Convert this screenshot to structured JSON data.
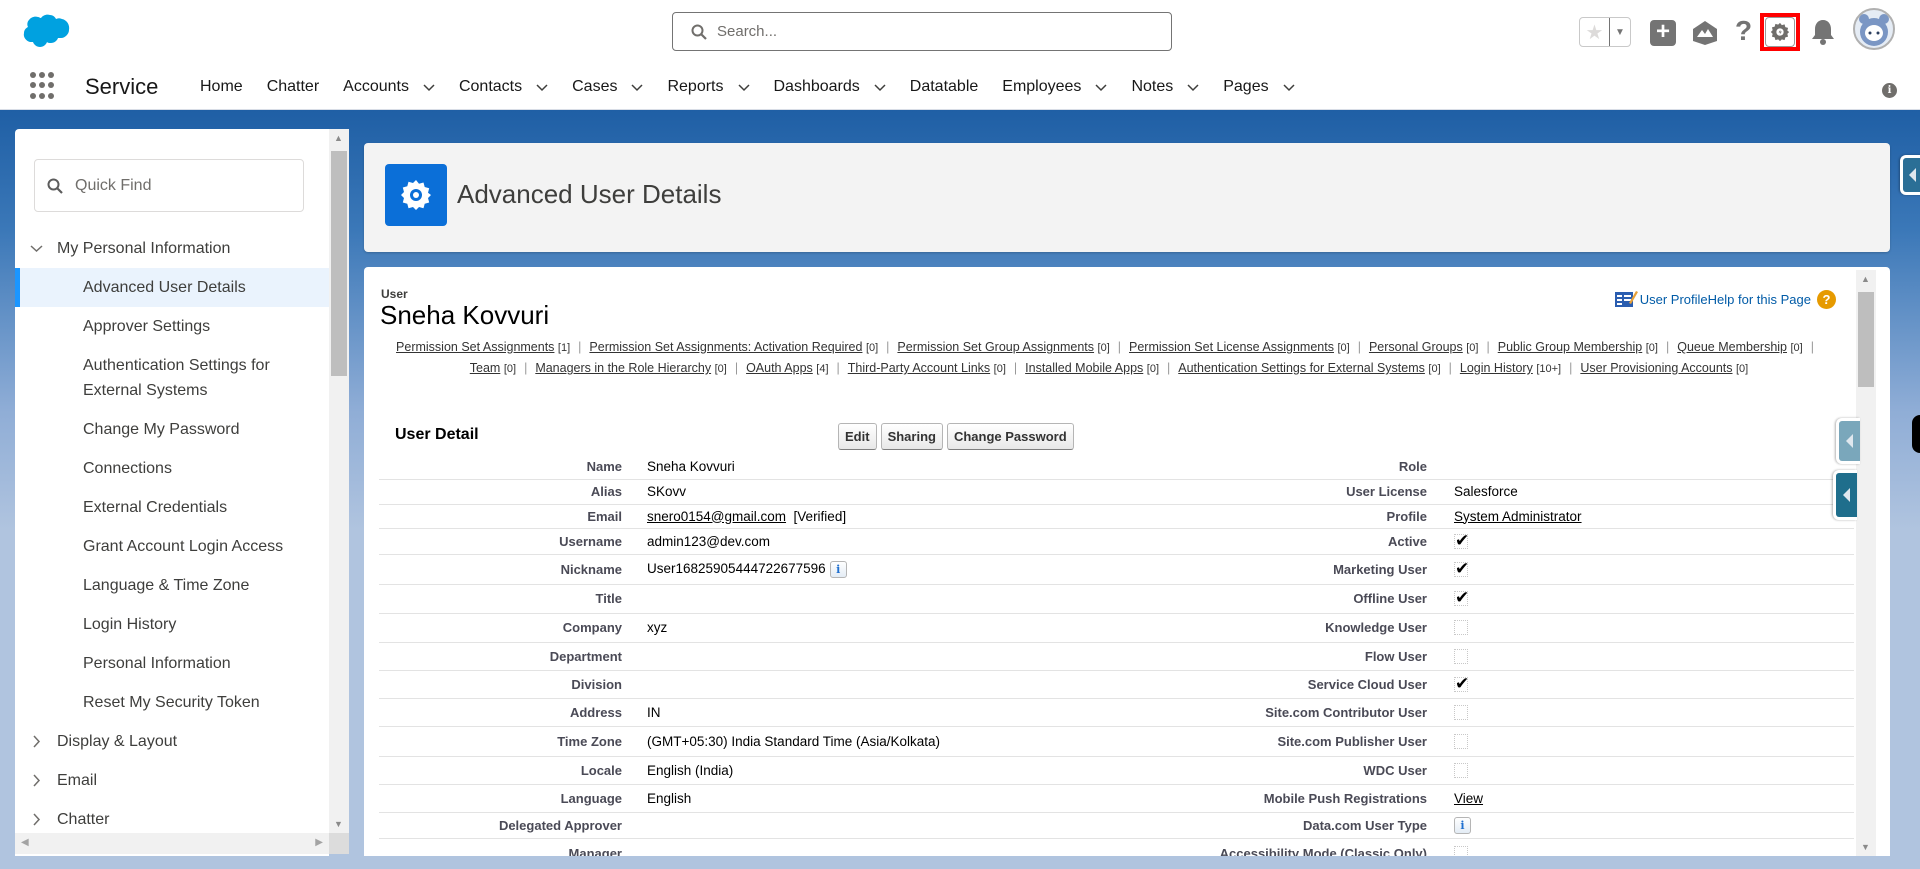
{
  "header": {
    "search_placeholder": "Search...",
    "icons": [
      "salesforce-logo",
      "favorites-star-icon",
      "favorites-dropdown-icon",
      "global-actions-plus-icon",
      "trailhead-icon",
      "help-icon",
      "setup-gear-icon",
      "notifications-bell-icon",
      "user-avatar"
    ],
    "highlight_color": "#ff0000"
  },
  "app_nav": {
    "app_name": "Service",
    "items": [
      {
        "label": "Home",
        "dropdown": false
      },
      {
        "label": "Chatter",
        "dropdown": false
      },
      {
        "label": "Accounts",
        "dropdown": true
      },
      {
        "label": "Contacts",
        "dropdown": true
      },
      {
        "label": "Cases",
        "dropdown": true
      },
      {
        "label": "Reports",
        "dropdown": true
      },
      {
        "label": "Dashboards",
        "dropdown": true
      },
      {
        "label": "Datatable",
        "dropdown": false
      },
      {
        "label": "Employees",
        "dropdown": true
      },
      {
        "label": "Notes",
        "dropdown": true
      },
      {
        "label": "Pages",
        "dropdown": true
      }
    ]
  },
  "sidebar": {
    "quick_find_placeholder": "Quick Find",
    "sections": [
      {
        "label": "My Personal Information",
        "expanded": true,
        "children": [
          {
            "label": "Advanced User Details",
            "selected": true
          },
          {
            "label": "Approver Settings",
            "selected": false
          },
          {
            "label": "Authentication Settings for External Systems",
            "selected": false
          },
          {
            "label": "Change My Password",
            "selected": false
          },
          {
            "label": "Connections",
            "selected": false
          },
          {
            "label": "External Credentials",
            "selected": false
          },
          {
            "label": "Grant Account Login Access",
            "selected": false
          },
          {
            "label": "Language & Time Zone",
            "selected": false
          },
          {
            "label": "Login History",
            "selected": false
          },
          {
            "label": "Personal Information",
            "selected": false
          },
          {
            "label": "Reset My Security Token",
            "selected": false
          }
        ]
      },
      {
        "label": "Display & Layout",
        "expanded": false
      },
      {
        "label": "Email",
        "expanded": false
      },
      {
        "label": "Chatter",
        "expanded": false
      }
    ]
  },
  "page": {
    "title": "Advanced User Details",
    "title_icon_color": "#0b6fd8"
  },
  "user": {
    "type_label": "User",
    "name": "Sneha Kovvuri",
    "profile_link": "User Profile",
    "help_link": "Help for this Page"
  },
  "related_links": [
    {
      "label": "Permission Set Assignments",
      "count": "[1]"
    },
    {
      "label": "Permission Set Assignments: Activation Required",
      "count": "[0]"
    },
    {
      "label": "Permission Set Group Assignments",
      "count": "[0]"
    },
    {
      "label": "Permission Set License Assignments",
      "count": "[0]"
    },
    {
      "label": "Personal Groups",
      "count": "[0]"
    },
    {
      "label": "Public Group Membership",
      "count": "[0]"
    },
    {
      "label": "Queue Membership",
      "count": "[0]"
    },
    {
      "label": "Team",
      "count": "[0]"
    },
    {
      "label": "Managers in the Role Hierarchy",
      "count": "[0]"
    },
    {
      "label": "OAuth Apps",
      "count": "[4]"
    },
    {
      "label": "Third-Party Account Links",
      "count": "[0]"
    },
    {
      "label": "Installed Mobile Apps",
      "count": "[0]"
    },
    {
      "label": "Authentication Settings for External Systems",
      "count": "[0]"
    },
    {
      "label": "Login History",
      "count": "[10+]"
    },
    {
      "label": "User Provisioning Accounts",
      "count": "[0]"
    }
  ],
  "user_detail": {
    "section_title": "User Detail",
    "buttons": {
      "edit": "Edit",
      "sharing": "Sharing",
      "change_password": "Change Password"
    },
    "rows": [
      {
        "left_label": "Name",
        "left_value": "Sneha Kovvuri",
        "right_label": "Role",
        "right_value": ""
      },
      {
        "left_label": "Alias",
        "left_value": "SKovv",
        "right_label": "User License",
        "right_value": "Salesforce"
      },
      {
        "left_label": "Email",
        "left_value": "snero0154@gmail.com",
        "left_suffix": "[Verified]",
        "right_label": "Profile",
        "right_value": "System Administrator"
      },
      {
        "left_label": "Username",
        "left_value": "admin123@dev.com",
        "right_label": "Active",
        "right_checked": true
      },
      {
        "left_label": "Nickname",
        "left_value": "User16825905444722677596",
        "right_label": "Marketing User",
        "right_checked": true
      },
      {
        "left_label": "Title",
        "left_value": "",
        "right_label": "Offline User",
        "right_checked": true
      },
      {
        "left_label": "Company",
        "left_value": "xyz",
        "right_label": "Knowledge User",
        "right_checked": false
      },
      {
        "left_label": "Department",
        "left_value": "",
        "right_label": "Flow User",
        "right_checked": false
      },
      {
        "left_label": "Division",
        "left_value": "",
        "right_label": "Service Cloud User",
        "right_checked": true
      },
      {
        "left_label": "Address",
        "left_value": "IN",
        "right_label": "Site.com Contributor User",
        "right_checked": false
      },
      {
        "left_label": "Time Zone",
        "left_value": "(GMT+05:30) India Standard Time (Asia/Kolkata)",
        "right_label": "Site.com Publisher User",
        "right_checked": false
      },
      {
        "left_label": "Locale",
        "left_value": "English (India)",
        "right_label": "WDC User",
        "right_checked": false
      },
      {
        "left_label": "Language",
        "left_value": "English",
        "right_label": "Mobile Push Registrations",
        "right_value": "View"
      },
      {
        "left_label": "Delegated Approver",
        "left_value": "",
        "right_label": "Data.com User Type",
        "right_value": ""
      },
      {
        "left_label": "Manager",
        "left_value": "",
        "right_label": "Accessibility Mode (Classic Only)",
        "right_checked": false
      }
    ]
  }
}
